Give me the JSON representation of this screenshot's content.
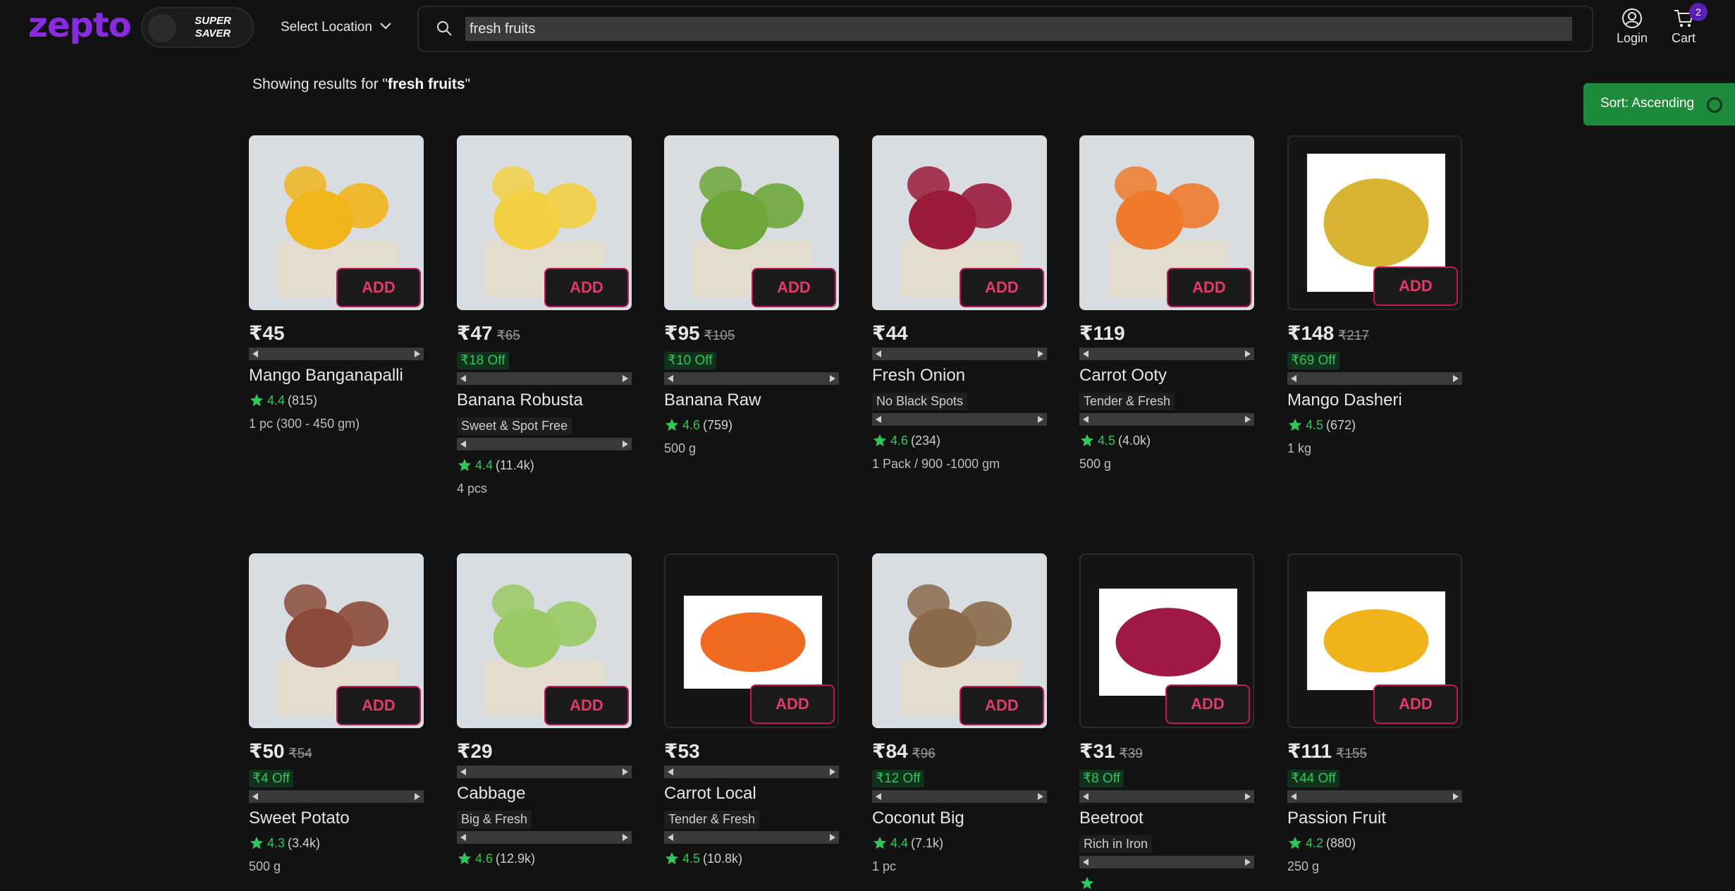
{
  "header": {
    "logo": "zepto",
    "saver_line1": "SUPER",
    "saver_line2": "SAVER",
    "location_label": "Select Location",
    "search_value": "fresh fruits",
    "login_label": "Login",
    "cart_label": "Cart",
    "cart_count": "2"
  },
  "results": {
    "prefix": "Showing results for \"",
    "query": "fresh fruits",
    "suffix": "\""
  },
  "sort_label": "Sort: Ascending",
  "add_label": "ADD",
  "colors": {
    "brand": "#8a2be2",
    "add_border": "#c2185b",
    "discount": "#2fc65a",
    "sort_bg": "#1e8a3c"
  },
  "products": [
    {
      "price": "₹45",
      "old": "",
      "off": "",
      "name": "Mango Banganapalli",
      "tag": "",
      "rating": "4.4",
      "count": "(815)",
      "qty": "1 pc (300 - 450 gm)"
    },
    {
      "price": "₹47",
      "old": "₹65",
      "off": "₹18 Off",
      "name": "Banana Robusta",
      "tag": "Sweet & Spot Free",
      "rating": "4.4",
      "count": "(11.4k)",
      "qty": "4 pcs"
    },
    {
      "price": "₹95",
      "old": "₹105",
      "off": "₹10 Off",
      "name": "Banana Raw",
      "tag": "",
      "rating": "4.6",
      "count": "(759)",
      "qty": "500 g"
    },
    {
      "price": "₹44",
      "old": "",
      "off": "",
      "name": "Fresh Onion",
      "tag": "No Black Spots",
      "rating": "4.6",
      "count": "(234)",
      "qty": "1 Pack / 900 -1000 gm"
    },
    {
      "price": "₹119",
      "old": "",
      "off": "",
      "name": "Carrot Ooty",
      "tag": "Tender & Fresh",
      "rating": "4.5",
      "count": "(4.0k)",
      "qty": "500 g"
    },
    {
      "price": "₹148",
      "old": "₹217",
      "off": "₹69 Off",
      "name": "Mango Dasheri",
      "tag": "",
      "rating": "4.5",
      "count": "(672)",
      "qty": "1 kg"
    },
    {
      "price": "₹50",
      "old": "₹54",
      "off": "₹4 Off",
      "name": "Sweet Potato",
      "tag": "",
      "rating": "4.3",
      "count": "(3.4k)",
      "qty": "500 g"
    },
    {
      "price": "₹29",
      "old": "",
      "off": "",
      "name": "Cabbage",
      "tag": "Big & Fresh",
      "rating": "4.6",
      "count": "(12.9k)",
      "qty": ""
    },
    {
      "price": "₹53",
      "old": "",
      "off": "",
      "name": "Carrot Local",
      "tag": "Tender & Fresh",
      "rating": "4.5",
      "count": "(10.8k)",
      "qty": ""
    },
    {
      "price": "₹84",
      "old": "₹96",
      "off": "₹12 Off",
      "name": "Coconut Big",
      "tag": "",
      "rating": "4.4",
      "count": "(7.1k)",
      "qty": "1 pc"
    },
    {
      "price": "₹31",
      "old": "₹39",
      "off": "₹8 Off",
      "name": "Beetroot",
      "tag": "Rich in Iron",
      "rating": "",
      "count": "",
      "qty": ""
    },
    {
      "price": "₹111",
      "old": "₹155",
      "off": "₹44 Off",
      "name": "Passion Fruit",
      "tag": "",
      "rating": "4.2",
      "count": "(880)",
      "qty": "250 g"
    }
  ]
}
